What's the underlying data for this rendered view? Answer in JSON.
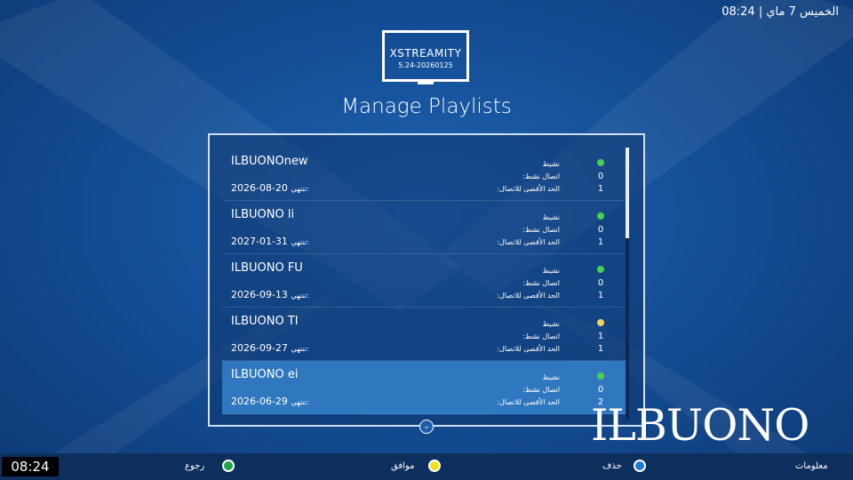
{
  "status": {
    "time": "08:24",
    "date": "الخميس 7 ماي",
    "separator": "|"
  },
  "logo": {
    "name": "STREAMITY",
    "mark": "X",
    "version": "5.24-20260125"
  },
  "page": {
    "title": "Manage Playlists"
  },
  "labels": {
    "status": "نشيط",
    "active_connections": "اتصال نشط:",
    "max_connections": "الحد الأقصى للاتصال:",
    "expires": "تنتهي:"
  },
  "playlists": [
    {
      "name": "ILBUONOnew",
      "expiry": "2026-08-20",
      "active": "0",
      "max": "1",
      "status_color": "#47d14f"
    },
    {
      "name": "ILBUONO li",
      "expiry": "2027-01-31",
      "active": "0",
      "max": "1",
      "status_color": "#47d14f"
    },
    {
      "name": "ILBUONO FU",
      "expiry": "2026-09-13",
      "active": "0",
      "max": "1",
      "status_color": "#47d14f"
    },
    {
      "name": "ILBUONO TI",
      "expiry": "2026-09-27",
      "active": "1",
      "max": "1",
      "status_color": "#f2d35a"
    },
    {
      "name": "ILBUONO ei",
      "expiry": "2026-06-29",
      "active": "0",
      "max": "2",
      "status_color": "#47d14f"
    }
  ],
  "selected_index": 4,
  "scroll_chevron": "⌄",
  "brand": "ILBUONO",
  "footer": {
    "clock": "08:24",
    "back": {
      "label": "رجوع",
      "color": "#22a34a"
    },
    "ok": {
      "label": "موافق",
      "color": "#f2e21a"
    },
    "delete": {
      "label": "حذف",
      "color": "#1a78d8"
    },
    "info": {
      "label": "معلومات"
    }
  }
}
